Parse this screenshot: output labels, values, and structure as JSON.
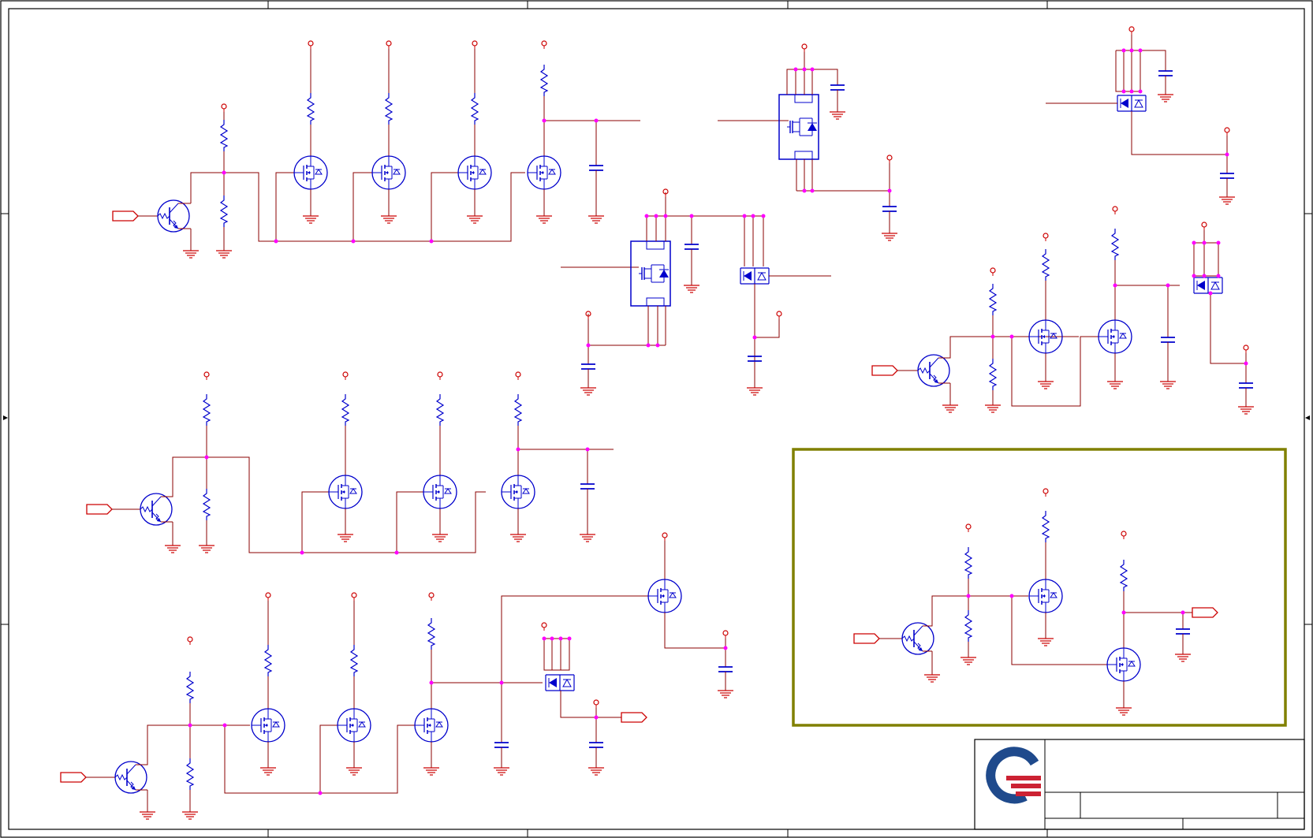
{
  "title": "",
  "colors": {
    "frame": "#000000",
    "wire": "#8b0000",
    "component": "#0000cc",
    "power": "#cc0000",
    "junction": "#ff00ff",
    "highlight": "#808000",
    "logo_blue": "#1f4a8c",
    "logo_red": "#cc2233"
  },
  "title_block": {
    "logo": "company-logo"
  }
}
